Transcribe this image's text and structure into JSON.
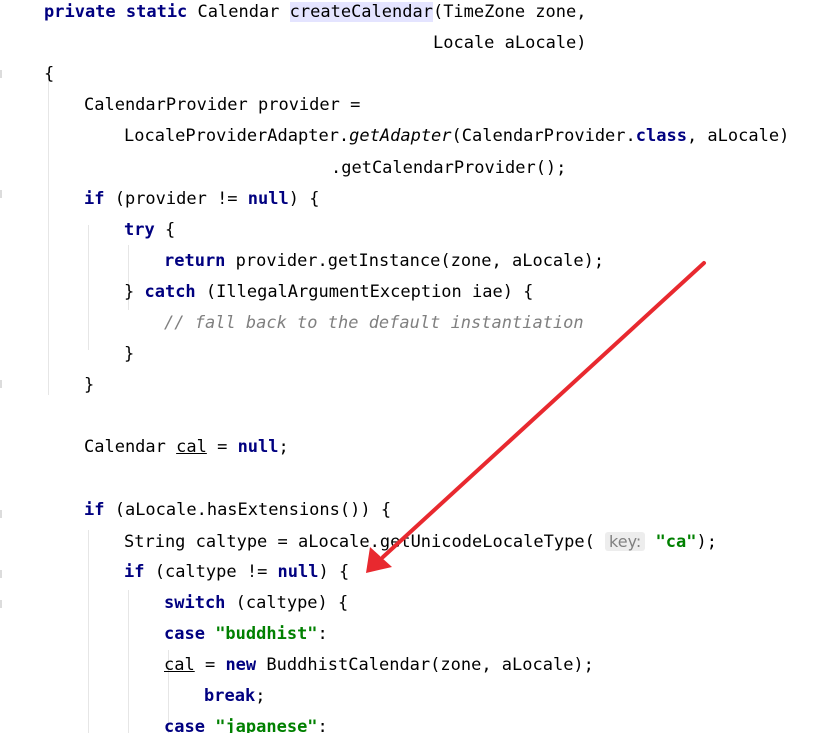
{
  "editor": {
    "lines": [
      [
        [
          "kw",
          "private static "
        ],
        [
          "",
          "Calendar "
        ],
        [
          "hl",
          "createCalendar"
        ],
        [
          "",
          "(TimeZone zone,"
        ]
      ],
      [
        [
          "",
          "Locale aLocale)"
        ]
      ],
      [
        [
          "",
          "{"
        ]
      ],
      [
        [
          "",
          "CalendarProvider provider ="
        ]
      ],
      [
        [
          "",
          "LocaleProviderAdapter."
        ],
        [
          "mth",
          "getAdapter"
        ],
        [
          "",
          "(CalendarProvider."
        ],
        [
          "kw",
          "class"
        ],
        [
          "",
          ", aLocale)"
        ]
      ],
      [
        [
          "",
          ".getCalendarProvider();"
        ]
      ],
      [
        [
          "kw",
          "if "
        ],
        [
          "",
          "(provider != "
        ],
        [
          "kw",
          "null"
        ],
        [
          "",
          ") {"
        ]
      ],
      [
        [
          "kw",
          "try "
        ],
        [
          "",
          "{"
        ]
      ],
      [
        [
          "kw",
          "return "
        ],
        [
          "",
          "provider.getInstance(zone, aLocale);"
        ]
      ],
      [
        [
          "",
          "} "
        ],
        [
          "kw",
          "catch "
        ],
        [
          "",
          "(IllegalArgumentException iae) {"
        ]
      ],
      [
        [
          "cmt",
          "// fall back to the default instantiation"
        ]
      ],
      [
        [
          "",
          "}"
        ]
      ],
      [
        [
          "",
          "}"
        ]
      ],
      [],
      [
        [
          "",
          "Calendar "
        ],
        [
          "ul",
          "cal"
        ],
        [
          "",
          " = "
        ],
        [
          "kw",
          "null"
        ],
        [
          "",
          ";"
        ]
      ],
      [],
      [
        [
          "kw",
          "if "
        ],
        [
          "",
          "(aLocale.hasExtensions()) {"
        ]
      ],
      [
        [
          "",
          "String caltype = aLocale.getUnicodeLocaleType( "
        ],
        [
          "hint",
          "key:"
        ],
        [
          "",
          " "
        ],
        [
          "str",
          "\"ca\""
        ],
        [
          "",
          ");"
        ]
      ],
      [
        [
          "kw",
          "if "
        ],
        [
          "",
          "(caltype != "
        ],
        [
          "kw",
          "null"
        ],
        [
          "",
          ") {"
        ]
      ],
      [
        [
          "kw",
          "switch "
        ],
        [
          "",
          "(caltype) {"
        ]
      ],
      [
        [
          "kw",
          "case "
        ],
        [
          "str",
          "\"buddhist\""
        ],
        [
          "",
          ":"
        ]
      ],
      [
        [
          "ul",
          "cal"
        ],
        [
          "",
          " = "
        ],
        [
          "kw",
          "new "
        ],
        [
          "",
          "BuddhistCalendar(zone, aLocale);"
        ]
      ],
      [
        [
          "kw",
          "break"
        ],
        [
          "",
          ";"
        ]
      ],
      [
        [
          "kw",
          "case "
        ],
        [
          "str",
          "\"japanese\""
        ],
        [
          "",
          ":"
        ]
      ]
    ]
  }
}
